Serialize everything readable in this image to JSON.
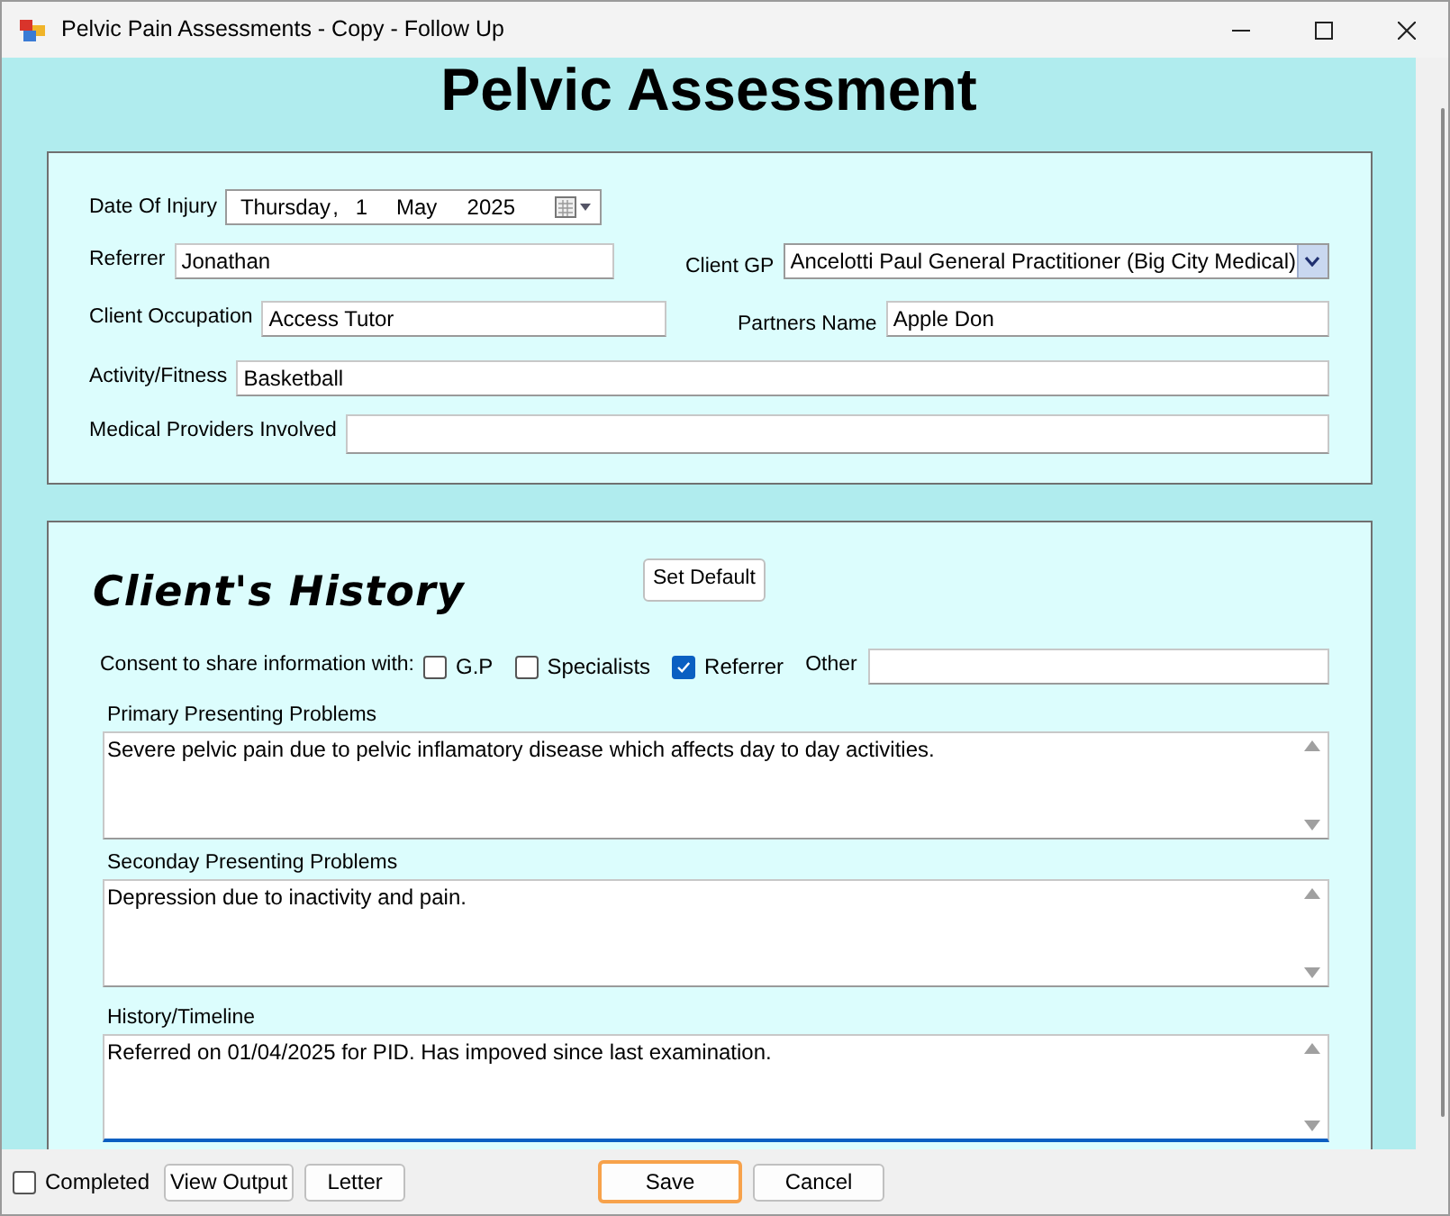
{
  "window": {
    "title": "Pelvic Pain Assessments - Copy - Follow Up"
  },
  "heading": "Pelvic Assessment",
  "details": {
    "date_of_injury": {
      "label": "Date Of Injury",
      "day_name": "Thursday",
      "separator": ",",
      "day": "1",
      "month": "May",
      "year": "2025"
    },
    "rows": [
      [
        {
          "kind": "text",
          "label": "Referrer",
          "value": "Jonathan"
        },
        {
          "kind": "combo",
          "label": "Client GP",
          "value": "Ancelotti Paul General Practitioner (Big City Medical)"
        }
      ],
      [
        {
          "kind": "text",
          "label": "Client Occupation",
          "value": "Access Tutor"
        },
        {
          "kind": "text",
          "label": "Partners Name",
          "value": "Apple Don"
        }
      ],
      [
        {
          "kind": "text",
          "label": "Activity/Fitness",
          "value": "Basketball"
        }
      ],
      [
        {
          "kind": "text",
          "label": "Medical Providers Involved"
        }
      ]
    ]
  },
  "history": {
    "title": "Client's History",
    "set_default": "Set Default",
    "consent_label": "Consent to share information with:",
    "consent_options": [
      {
        "label": "G.P",
        "checked": false
      },
      {
        "label": "Specialists",
        "checked": false
      },
      {
        "label": "Referrer",
        "checked": true
      }
    ],
    "other_label": "Other",
    "text_areas": [
      {
        "label": "Primary Presenting Problems",
        "value": "Severe pelvic pain due to pelvic inflamatory disease which affects day to day activities.",
        "focused": false
      },
      {
        "label": "Seconday Presenting Problems",
        "value": "Depression due to inactivity and pain.",
        "focused": false
      },
      {
        "label": "History/Timeline",
        "value": "Referred on 01/04/2025 for PID. Has impoved since last examination.",
        "focused": true
      }
    ]
  },
  "footer": {
    "completed": {
      "label": "Completed",
      "checked": false
    },
    "left_buttons": [
      {
        "label": "View Output",
        "focused": false
      },
      {
        "label": "Letter",
        "focused": false
      }
    ],
    "right_buttons": [
      {
        "label": "Save",
        "focused": true
      },
      {
        "label": "Cancel",
        "focused": false
      }
    ]
  }
}
